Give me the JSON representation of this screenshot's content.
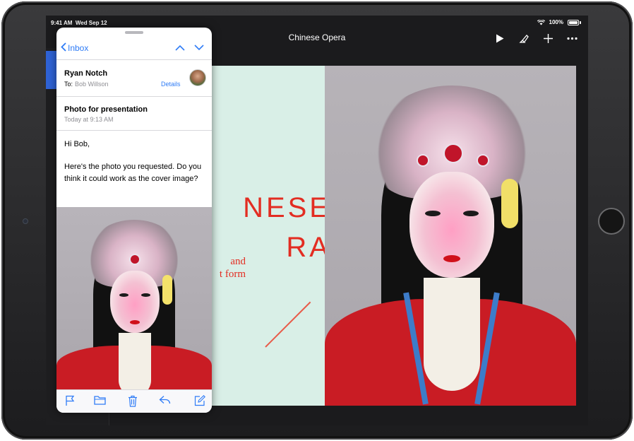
{
  "status_bar": {
    "time": "9:41 AM",
    "date": "Wed Sep 12",
    "battery": "100%"
  },
  "keynote": {
    "title": "Chinese Opera",
    "toolbar_icons": [
      "play-icon",
      "format-brush-icon",
      "add-icon",
      "more-icon"
    ],
    "slide": {
      "title_lines": "NESE\nRA",
      "subtitle_lines": "and\nt form"
    }
  },
  "mail": {
    "back_label": "Inbox",
    "sender": "Ryan Notch",
    "to_label": "To:",
    "to_name": "Bob Willson",
    "details_label": "Details",
    "subject": "Photo for presentation",
    "date": "Today at 9:13 AM",
    "greeting": "Hi Bob,",
    "message": "Here's the photo you requested. Do you think it could work as the cover image?",
    "toolbar_icons": [
      "flag-icon",
      "folder-icon",
      "trash-icon",
      "reply-icon",
      "compose-icon"
    ]
  },
  "colors": {
    "accent": "#2f7cf6",
    "slide_bg": "#d9efe7",
    "slide_title": "#e32d22",
    "nav_selected": "#2f63d6"
  }
}
